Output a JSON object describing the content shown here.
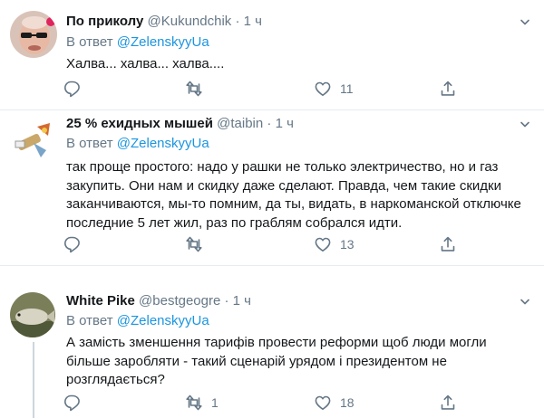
{
  "tweets": [
    {
      "name": "По приколу",
      "handle": "@Kukundchik",
      "dot": "·",
      "time": "1 ч",
      "reply_prefix": "В ответ",
      "reply_to": "@ZelenskyyUa",
      "text": "Халва... халва... халва....",
      "retweets": "",
      "likes": "11"
    },
    {
      "name": "25 % ехидных мышей",
      "handle": "@taibin",
      "dot": "·",
      "time": "1 ч",
      "reply_prefix": "В ответ",
      "reply_to": "@ZelenskyyUa",
      "text": "так проще простого: надо у рашки не только электричество, но и газ закупить. Они нам и скидку даже сделают. Правда, чем такие скидки заканчиваются, мы-то помним, да ты, видать, в наркоманской отключке последние 5 лет жил, раз по граблям собрался идти.",
      "retweets": "",
      "likes": "13"
    },
    {
      "name": "White Pike",
      "handle": "@bestgeogre",
      "dot": "·",
      "time": "1 ч",
      "reply_prefix": "В ответ",
      "reply_to": "@ZelenskyyUa",
      "text": "А замість зменшення тарифів провести реформи щоб люди могли більше заробляти - такий сценарій урядом і президентом не розглядається?",
      "retweets": "1",
      "likes": "18"
    }
  ],
  "icons": {
    "reply": "reply-icon",
    "retweet": "retweet-icon",
    "like": "heart-icon",
    "share": "share-icon",
    "more": "chevron-down-icon"
  },
  "colors": {
    "text": "#14171a",
    "secondary": "#657786",
    "link": "#1b95e0",
    "divider": "#e6ecf0"
  }
}
